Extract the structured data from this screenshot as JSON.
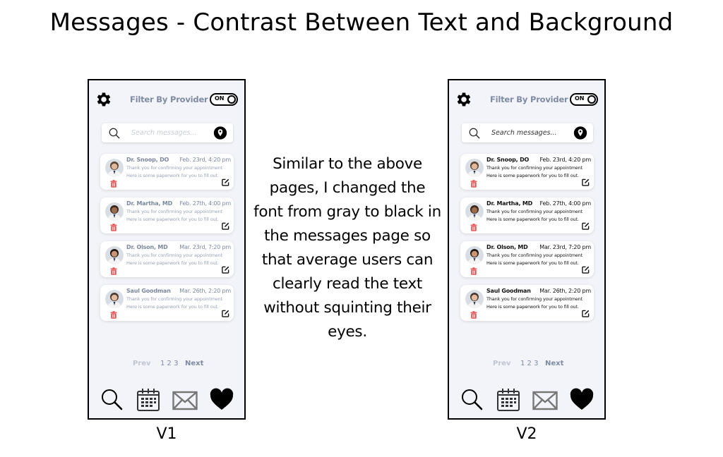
{
  "title": "Messages - Contrast Between Text and Background",
  "note": "Similar to the above pages, I changed the font from gray to black in the messages page so that average users can clearly read the text without squinting their eyes.",
  "colors": {
    "screen_bg": "#f3f4f9",
    "v1_text_gray": "#7c879e",
    "v1_body_gray": "#9aa3b5",
    "v2_text_black": "#111111",
    "trash_red": "#e14b4b",
    "accent_slate": "#7f8aa3"
  },
  "versions": [
    {
      "label": "V1",
      "header": {
        "filter_label": "Filter By Provider",
        "toggle_label": "ON"
      },
      "search": {
        "placeholder": "Search messages..."
      },
      "messages": [
        {
          "sender": "Dr. Snoop, DO",
          "date": "Feb. 23rd, 4:20 pm",
          "line1": "Thank you for confirming your appointment",
          "line2": "Here is some paperwork for you to fill out."
        },
        {
          "sender": "Dr. Martha, MD",
          "date": "Feb. 27th, 4:00 pm",
          "line1": "Thank you for confirming your appointment",
          "line2": "Here is some paperwork for you to fill out."
        },
        {
          "sender": "Dr. Olson, MD",
          "date": "Mar. 23rd, 7:20 pm",
          "line1": "Thank you for confirming your appointment",
          "line2": "Here is some paperwork for you to fill out."
        },
        {
          "sender": "Saul Goodman",
          "date": "Mar. 26th, 2:20 pm",
          "line1": "Thank you for confirming your appointment",
          "line2": "Here is some paperwork for you to fill out."
        }
      ],
      "pager": {
        "prev": "Prev",
        "pages": "1 2 3",
        "next": "Next"
      },
      "nav": [
        "search-icon",
        "calendar-icon",
        "mail-icon",
        "heart-icon"
      ]
    },
    {
      "label": "V2",
      "header": {
        "filter_label": "Filter By Provider",
        "toggle_label": "ON"
      },
      "search": {
        "placeholder": "Search messages..."
      },
      "messages": [
        {
          "sender": "Dr. Snoop, DO",
          "date": "Feb. 23rd, 4:20 pm",
          "line1": "Thank you for confirming your appointment",
          "line2": "Here is some paperwork for you to fill out."
        },
        {
          "sender": "Dr. Martha, MD",
          "date": "Feb. 27th, 4:00 pm",
          "line1": "Thank you for confirming your appointment",
          "line2": "Here is some paperwork for you to fill out."
        },
        {
          "sender": "Dr. Olson, MD",
          "date": "Mar. 23rd, 7:20 pm",
          "line1": "Thank you for confirming your appointment",
          "line2": "Here is some paperwork for you to fill out."
        },
        {
          "sender": "Saul Goodman",
          "date": "Mar. 26th, 2:20 pm",
          "line1": "Thank you for confirming your appointment",
          "line2": "Here is some paperwork for you to fill out."
        }
      ],
      "pager": {
        "prev": "Prev",
        "pages": "1 2 3",
        "next": "Next"
      },
      "nav": [
        "search-icon",
        "calendar-icon",
        "mail-icon",
        "heart-icon"
      ]
    }
  ]
}
